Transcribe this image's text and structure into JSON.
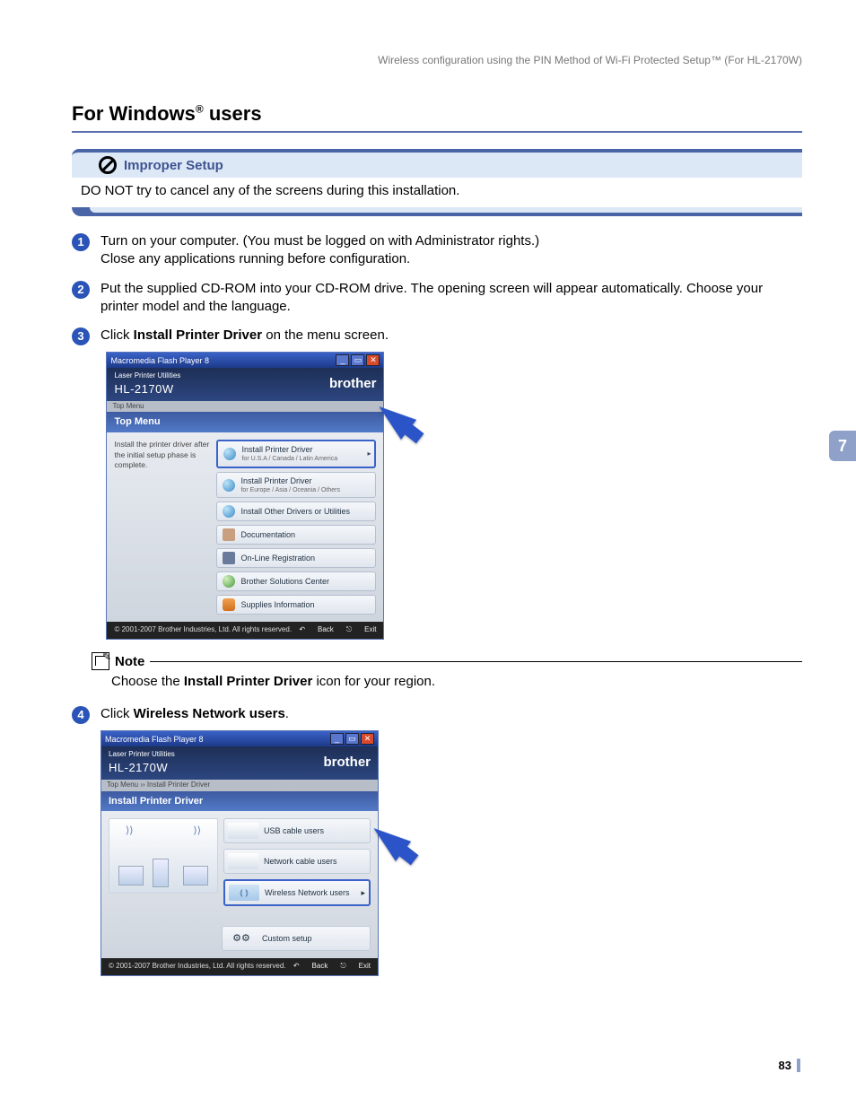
{
  "running_head": "Wireless configuration using the PIN Method of Wi-Fi Protected Setup™ (For HL-2170W)",
  "chapter_tab": "7",
  "page_number": "83",
  "section": {
    "title_prefix": "For Windows",
    "title_reg": "®",
    "title_suffix": " users"
  },
  "warning": {
    "title": "Improper Setup",
    "body": "DO NOT try to cancel any of the screens during this installation."
  },
  "steps": {
    "s1": {
      "num": "1",
      "text": "Turn on your computer. (You must be logged on with Administrator rights.)",
      "text2": "Close any applications running before configuration."
    },
    "s2": {
      "num": "2",
      "text": "Put the supplied CD-ROM into your CD-ROM drive. The opening screen will appear automatically. Choose your printer model and the language."
    },
    "s3": {
      "num": "3",
      "pre": "Click ",
      "bold": "Install Printer Driver",
      "post": " on the menu screen."
    },
    "s4": {
      "num": "4",
      "pre": "Click ",
      "bold": "Wireless Network users",
      "post": "."
    }
  },
  "note": {
    "label": "Note",
    "body_pre": "Choose the ",
    "body_bold": "Install Printer Driver",
    "body_post": " icon for your region."
  },
  "shot1": {
    "title": "Macromedia Flash Player 8",
    "util": "Laser Printer Utilities",
    "model": "HL-2170W",
    "brand": "brother",
    "tab": "Top Menu",
    "head": "Top Menu",
    "side": "Install the printer driver after the initial setup phase is complete.",
    "items": {
      "i1": {
        "label": "Install Printer Driver",
        "sub": "for U.S.A / Canada / Latin America"
      },
      "i2": {
        "label": "Install Printer Driver",
        "sub": "for Europe / Asia / Oceania / Others"
      },
      "i3": {
        "label": "Install Other Drivers or Utilities"
      },
      "i4": {
        "label": "Documentation"
      },
      "i5": {
        "label": "On-Line Registration"
      },
      "i6": {
        "label": "Brother Solutions Center"
      },
      "i7": {
        "label": "Supplies Information"
      }
    },
    "footer_copy": "© 2001-2007 Brother Industries, Ltd. All rights reserved.",
    "back": "Back",
    "exit": "Exit"
  },
  "shot2": {
    "title": "Macromedia Flash Player 8",
    "util": "Laser Printer Utilities",
    "model": "HL-2170W",
    "brand": "brother",
    "tab": "Top Menu  ››  Install Printer Driver",
    "head": "Install Printer Driver",
    "opts": {
      "o1": "USB cable users",
      "o2": "Network cable users",
      "o3": "Wireless Network users",
      "o4": "Custom setup"
    },
    "footer_copy": "© 2001-2007 Brother Industries, Ltd. All rights reserved.",
    "back": "Back",
    "exit": "Exit"
  }
}
